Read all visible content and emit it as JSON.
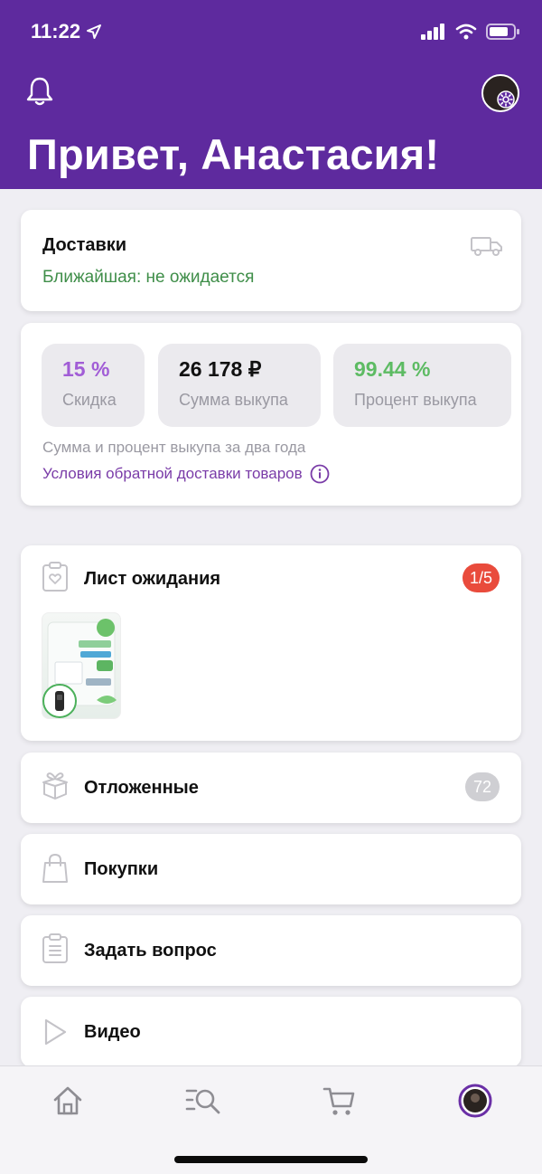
{
  "status_bar": {
    "time": "11:22"
  },
  "header": {
    "greeting": "Привет, Анастасия!"
  },
  "delivery": {
    "title": "Доставки",
    "subtitle": "Ближайшая: не ожидается"
  },
  "stats": {
    "items": [
      {
        "value": "15 %",
        "label": "Скидка",
        "color": "#a15dd6"
      },
      {
        "value": "26 178 ₽",
        "label": "Сумма выкупа",
        "color": "#111111"
      },
      {
        "value": "99.44 %",
        "label": "Процент выкупа",
        "color": "#5dbb63"
      }
    ],
    "note": "Сумма и процент выкупа за два года",
    "link": "Условия обратной доставки товаров"
  },
  "menu": {
    "waitlist": {
      "label": "Лист ожидания",
      "badge": "1/5"
    },
    "deferred": {
      "label": "Отложенные",
      "badge": "72"
    },
    "purchases": {
      "label": "Покупки"
    },
    "ask": {
      "label": "Задать вопрос"
    },
    "video": {
      "label": "Видео"
    }
  },
  "icons": {
    "status": [
      "location-arrow-icon",
      "signal-icon",
      "wifi-icon",
      "battery-icon"
    ],
    "tabs": [
      "home-icon",
      "catalog-search-icon",
      "cart-icon",
      "profile-avatar-icon"
    ]
  },
  "colors": {
    "brand": "#5e2a9e",
    "accent_purple": "#7a3ca8",
    "green": "#3f8e49",
    "badge_red": "#e94b3c"
  }
}
